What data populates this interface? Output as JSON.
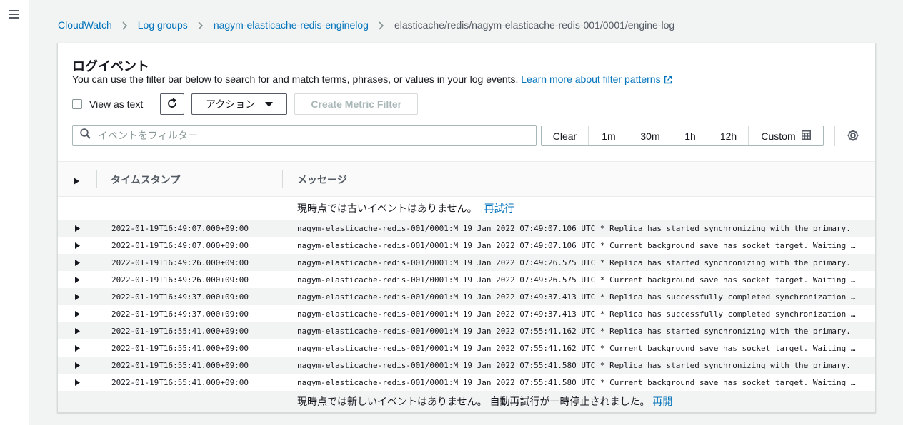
{
  "breadcrumb": {
    "items": [
      "CloudWatch",
      "Log groups",
      "nagym-elasticache-redis-enginelog"
    ],
    "current": "elasticache/redis/nagym-elasticache-redis-001/0001/engine-log"
  },
  "panel": {
    "title": "ログイベント",
    "description": "You can use the filter bar below to search for and match terms, phrases, or values in your log events.",
    "learn_more": "Learn more about filter patterns",
    "view_as_text": "View as text",
    "actions_label": "アクション",
    "create_metric_filter": "Create Metric Filter",
    "filter_placeholder": "イベントをフィルター"
  },
  "time_range": {
    "clear": "Clear",
    "options": [
      "1m",
      "30m",
      "1h",
      "12h"
    ],
    "custom": "Custom"
  },
  "table": {
    "col_timestamp": "タイムスタンプ",
    "col_message": "メッセージ",
    "no_older": "現時点では古いイベントはありません。",
    "retry": "再試行",
    "no_newer": "現時点では新しいイベントはありません。 自動再試行が一時停止されました。",
    "resume": "再開",
    "rows": [
      {
        "timestamp": "2022-01-19T16:49:07.000+09:00",
        "message": "nagym-elasticache-redis-001/0001:M 19 Jan 2022 07:49:07.106 UTC * Replica has started synchronizing with the primary."
      },
      {
        "timestamp": "2022-01-19T16:49:07.000+09:00",
        "message": "nagym-elasticache-redis-001/0001:M 19 Jan 2022 07:49:07.106 UTC * Current background save has socket target. Waiting for next BGSAVE for SYNC"
      },
      {
        "timestamp": "2022-01-19T16:49:26.000+09:00",
        "message": "nagym-elasticache-redis-001/0001:M 19 Jan 2022 07:49:26.575 UTC * Replica has started synchronizing with the primary."
      },
      {
        "timestamp": "2022-01-19T16:49:26.000+09:00",
        "message": "nagym-elasticache-redis-001/0001:M 19 Jan 2022 07:49:26.575 UTC * Current background save has socket target. Waiting for next BGSAVE for SYNC"
      },
      {
        "timestamp": "2022-01-19T16:49:37.000+09:00",
        "message": "nagym-elasticache-redis-001/0001:M 19 Jan 2022 07:49:37.413 UTC * Replica has successfully completed synchronization with the primary."
      },
      {
        "timestamp": "2022-01-19T16:49:37.000+09:00",
        "message": "nagym-elasticache-redis-001/0001:M 19 Jan 2022 07:49:37.413 UTC * Replica has successfully completed synchronization with the primary."
      },
      {
        "timestamp": "2022-01-19T16:55:41.000+09:00",
        "message": "nagym-elasticache-redis-001/0001:M 19 Jan 2022 07:55:41.162 UTC * Replica has started synchronizing with the primary."
      },
      {
        "timestamp": "2022-01-19T16:55:41.000+09:00",
        "message": "nagym-elasticache-redis-001/0001:M 19 Jan 2022 07:55:41.162 UTC * Current background save has socket target. Waiting for next BGSAVE for SYNC"
      },
      {
        "timestamp": "2022-01-19T16:55:41.000+09:00",
        "message": "nagym-elasticache-redis-001/0001:M 19 Jan 2022 07:55:41.580 UTC * Replica has started synchronizing with the primary."
      },
      {
        "timestamp": "2022-01-19T16:55:41.000+09:00",
        "message": "nagym-elasticache-redis-001/0001:M 19 Jan 2022 07:55:41.580 UTC * Current background save has socket target. Waiting for next BGSAVE for SYNC"
      }
    ]
  },
  "colors": {
    "link": "#0073bb",
    "page_bg": "#f2f3f3",
    "text": "#16191f",
    "muted": "#545b64"
  },
  "icons": [
    "menu-icon",
    "chevron-right-icon",
    "external-link-icon",
    "refresh-icon",
    "caret-down-icon",
    "search-icon",
    "calendar-icon",
    "gear-icon",
    "expand-triangle-icon"
  ]
}
